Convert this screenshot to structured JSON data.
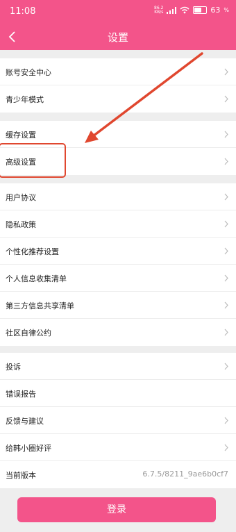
{
  "status_bar": {
    "time": "11:08",
    "net_speed_top": "86.2",
    "net_speed_bottom": "KB/s",
    "battery_percent": "63",
    "battery_level": 0.63
  },
  "header": {
    "title": "设置"
  },
  "groups": [
    {
      "items": [
        {
          "label": "账号安全中心"
        },
        {
          "label": "青少年模式"
        }
      ]
    },
    {
      "items": [
        {
          "label": "缓存设置"
        },
        {
          "label": "高级设置"
        }
      ]
    },
    {
      "items": [
        {
          "label": "用户协议"
        },
        {
          "label": "隐私政策"
        },
        {
          "label": "个性化推荐设置"
        },
        {
          "label": "个人信息收集清单"
        },
        {
          "label": "第三方信息共享清单"
        },
        {
          "label": "社区自律公约"
        }
      ]
    },
    {
      "items": [
        {
          "label": "投诉"
        },
        {
          "label": "错误报告"
        },
        {
          "label": "反馈与建议"
        },
        {
          "label": "给韩小圈好评"
        },
        {
          "label": "当前版本",
          "value": "6.7.5/8211_9ae6b0cf7"
        }
      ]
    }
  ],
  "login_button": {
    "label": "登录"
  },
  "colors": {
    "brand": "#f3548a",
    "annotation": "#e0472f"
  }
}
